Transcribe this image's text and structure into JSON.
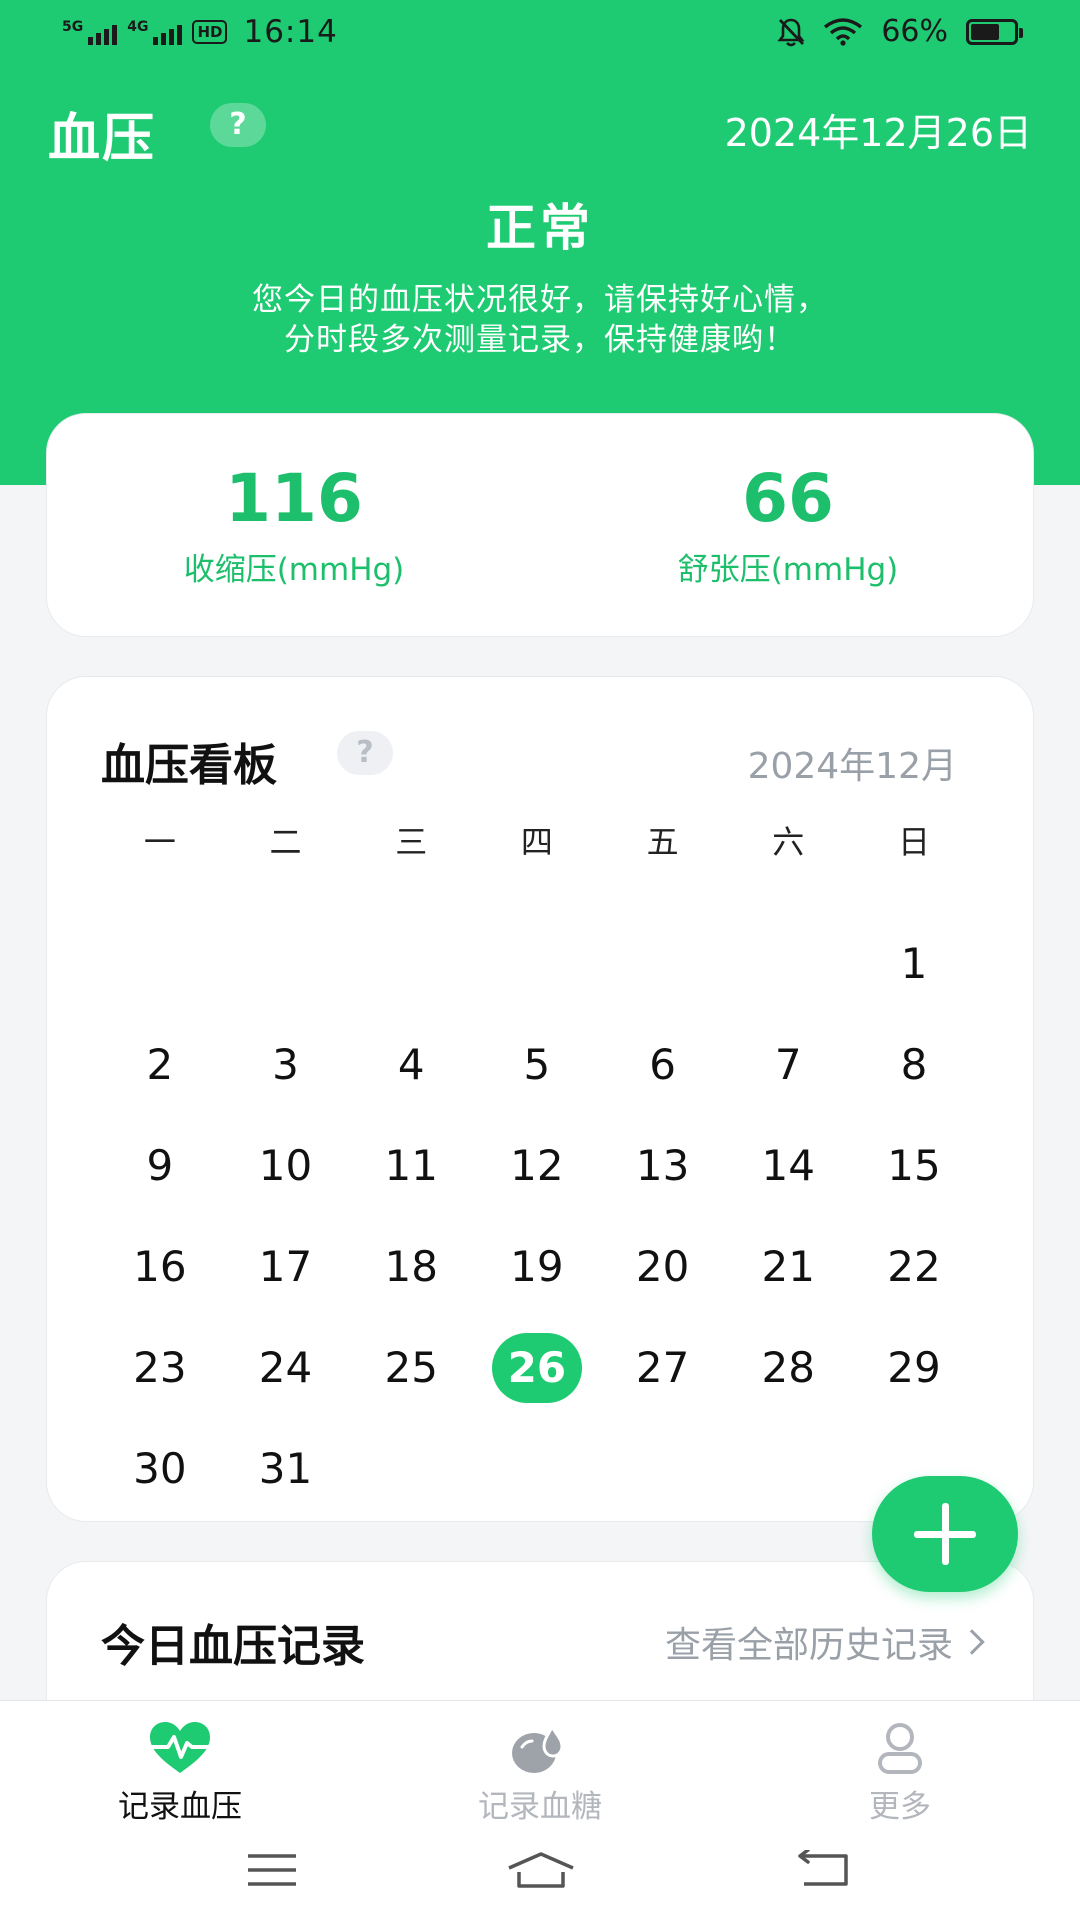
{
  "status_bar": {
    "sig1": "5G",
    "sig2": "4G",
    "hd": "HD",
    "time": "16:14",
    "battery": "66%",
    "battery_level": 0.66
  },
  "header": {
    "title": "血压",
    "help": "?",
    "date": "2024年12月26日",
    "status": "正常",
    "desc_line1": "您今日的血压状况很好，请保持好心情，",
    "desc_line2": "分时段多次测量记录，保持健康哟！"
  },
  "values": {
    "systolic": "116",
    "systolic_label": "收缩压(mmHg)",
    "diastolic": "66",
    "diastolic_label": "舒张压(mmHg)"
  },
  "calendar": {
    "title": "血压看板",
    "help": "?",
    "month": "2024年12月",
    "weekdays": [
      "一",
      "二",
      "三",
      "四",
      "五",
      "六",
      "日"
    ],
    "leading_blanks": 6,
    "days": [
      "1",
      "2",
      "3",
      "4",
      "5",
      "6",
      "7",
      "8",
      "9",
      "10",
      "11",
      "12",
      "13",
      "14",
      "15",
      "16",
      "17",
      "18",
      "19",
      "20",
      "21",
      "22",
      "23",
      "24",
      "25",
      "26",
      "27",
      "28",
      "29",
      "30",
      "31"
    ],
    "selected_day": "26"
  },
  "today": {
    "title": "今日血压记录",
    "history_link": "查看全部历史记录"
  },
  "nav": {
    "record_bp": "记录血压",
    "record_sugar": "记录血糖",
    "more": "更多"
  },
  "colors": {
    "accent": "#1ecb72",
    "muted": "#b3b7bd"
  }
}
